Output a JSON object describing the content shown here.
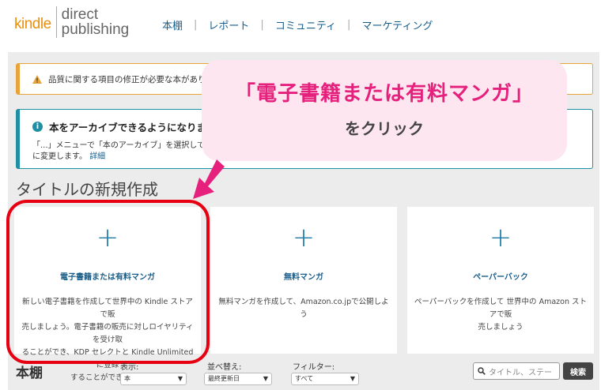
{
  "header": {
    "logo_kindle": "kindle",
    "logo_direct": "direct",
    "logo_publishing": "publishing",
    "nav": [
      "本棚",
      "レポート",
      "コミュニティ",
      "マーケティング"
    ]
  },
  "warning": {
    "text": "品質に関する項目の修正が必要な本がありま",
    "icon": "warning-triangle-icon",
    "color": "#e8a33a"
  },
  "info": {
    "title": "本をアーカイブできるようにな",
    "title_tail": "りました",
    "body_line1": "「...」メニューで「本のアーカイブ」を選択して",
    "body_line2": "に変更します。",
    "link": "詳細",
    "color": "#1f8fa3"
  },
  "section_title": "タイトルの新規作成",
  "cards": [
    {
      "title": "電子書籍または有料マンガ",
      "desc": [
        "新しい電子書籍を作成して世界中の Kindle ストアで販",
        "売しましょう。電子書籍の販売に対しロイヤリティを受け取",
        "ることができ、KDP セレクトと Kindle Unlimited に登録",
        "することができます。"
      ]
    },
    {
      "title": "無料マンガ",
      "desc": [
        "無料マンガを作成して、Amazon.co.jpで公開しよう"
      ]
    },
    {
      "title": "ペーパーバック",
      "desc": [
        "ペーパーバックを作成して 世界中の Amazon ストアで販",
        "売しましょう"
      ]
    }
  ],
  "bottom": {
    "shelf_title": "本棚",
    "view_label": "表示:",
    "view_value": "本",
    "sort_label": "並べ替え:",
    "sort_value": "最終更新日",
    "filter_label": "フィルター:",
    "filter_value": "すべて",
    "search_placeholder": "タイトル、ステー",
    "search_button": "検索"
  },
  "callout": {
    "main": "「電子書籍または有料マンガ」",
    "sub": "をクリック",
    "accent": "#e6217d",
    "outline": "#e60012"
  }
}
